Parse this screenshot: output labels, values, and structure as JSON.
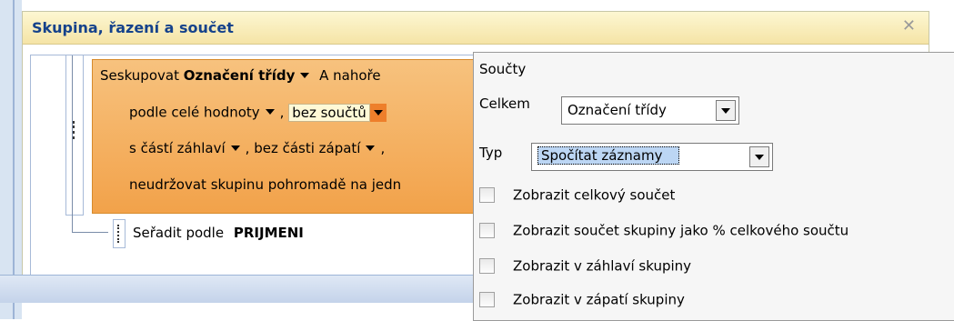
{
  "panel": {
    "title": "Skupina, řazení a součet",
    "close_icon": "close-icon"
  },
  "group": {
    "prefix": "Seskupovat",
    "field": "Označení třídy",
    "order_partial": "A nahoře",
    "row2_a": "podle celé hodnoty",
    "row2_b": "bez součtů",
    "row3_a": "s částí záhlaví",
    "row3_b": "bez části zápatí",
    "row4": "neudržovat skupinu pohromadě na jedn"
  },
  "sort": {
    "prefix": "Seřadit podle",
    "field": "PRIJMENI"
  },
  "popup": {
    "title": "Součty",
    "total_label": "Celkem",
    "total_value": "Označení třídy",
    "type_label": "Typ",
    "type_value": "Spočítat záznamy",
    "checkboxes": [
      {
        "label": "Zobrazit celkový součet",
        "checked": false
      },
      {
        "label": "Zobrazit součet skupiny jako % celkového součtu",
        "checked": false
      },
      {
        "label": "Zobrazit v záhlaví skupiny",
        "checked": false
      },
      {
        "label": "Zobrazit v zápatí skupiny",
        "checked": false
      }
    ]
  },
  "colors": {
    "title_text": "#15428b",
    "group_fill": "#f2a24a",
    "highlight_caret": "#ee7f2b",
    "selection": "#bcd6f4"
  }
}
